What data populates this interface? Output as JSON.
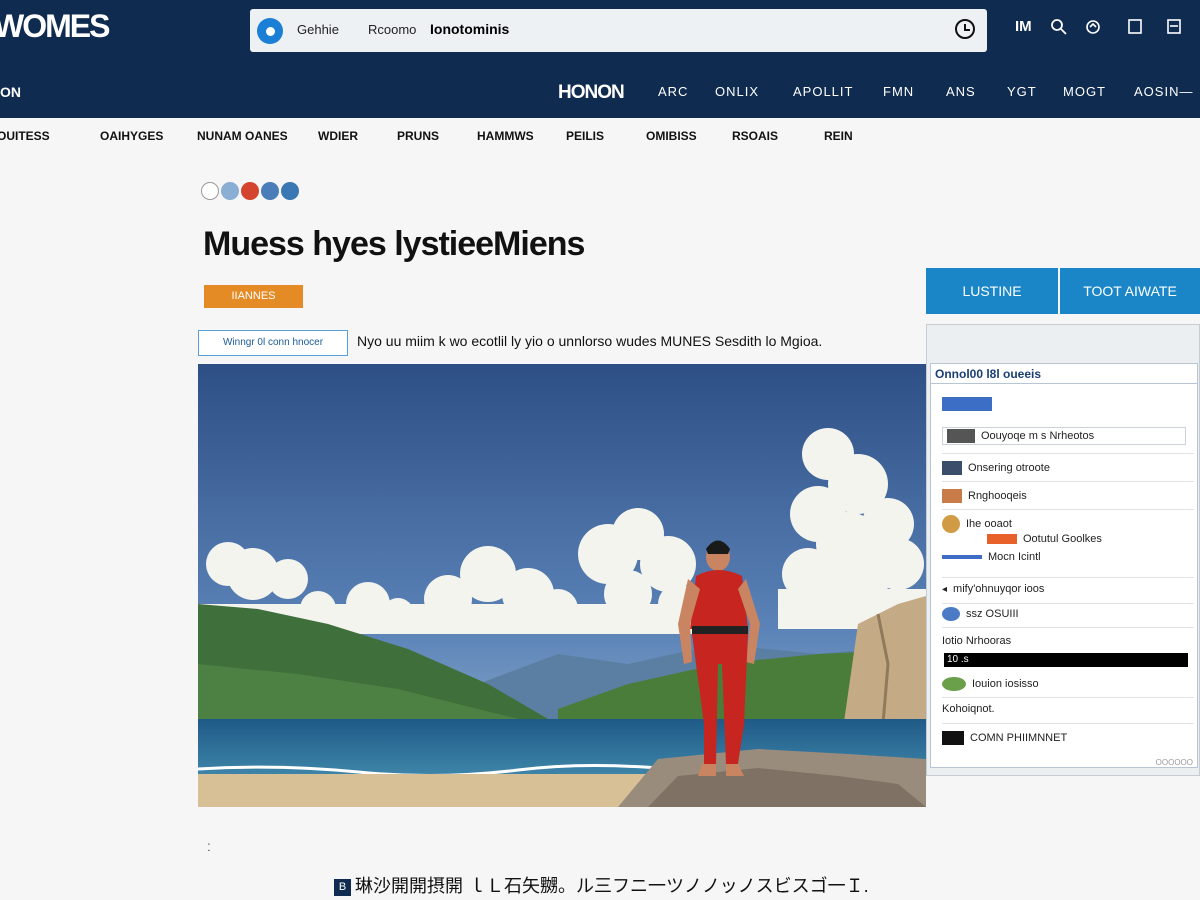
{
  "header": {
    "logo": "WOMES",
    "search": {
      "scope": "Gehhie",
      "query_label": "Rcoomo",
      "query": "Ionotominis"
    },
    "utility": {
      "im_label": "IM"
    },
    "section_label": "ON",
    "brand": "HONON",
    "nav_items": [
      "ARC",
      "ONLIX",
      "APOLLIT",
      "FMN",
      "ANS",
      "YGT",
      "MOGT",
      "AOSIN—"
    ]
  },
  "subnav": {
    "items": [
      "OUITESS",
      "OAIHYGES",
      "NUNAM OANES",
      "WDIER",
      "PRUNS",
      "HAMMWS",
      "PEILIS",
      "OMIBISS",
      "RSOAIS",
      "REIN"
    ]
  },
  "article": {
    "category_colors": [
      "#ffffff",
      "#8aaed4",
      "#d3452e",
      "#4b7eb8",
      "#3b77b3"
    ],
    "headline": "Muess hyes lystieeMiens",
    "tag": "IIANNES",
    "outline_button": "Winngr 0l conn hnocer",
    "intro": "Nyo uu miim k wo ecotlil ly yio o unnlorso wudes MUNES Sesdith lo Mgioa.",
    "footnote_mark": "ː",
    "footer_badge": "B",
    "footer_text": "琳沙開開摂開 ｌＬ石矢嬲。ル三フニ一ツノノッノスビスゴ一Ｉ."
  },
  "sidebar": {
    "tab_left": "LUSTINE",
    "tab_right": "TOOT AIWATE",
    "panel_title": "Onnol00 l8l oueeis",
    "rows": [
      {
        "text": "",
        "thumb": "#3b6ec4"
      },
      {
        "text": "Oouyoqe m s Nrheotos",
        "thumb": "#555"
      },
      {
        "text": "Onsering otroote",
        "thumb": "#3b4d6a"
      },
      {
        "text": "Rnghooqeis",
        "thumb": "#c97b4a"
      },
      {
        "text": "Ihe ooaot",
        "thumb": "#d09b44"
      },
      {
        "text": "Ootutul Goolkes",
        "thumb": "#e8602a"
      },
      {
        "text": "Mocn Icintl",
        "thumb": "#3b6ec4"
      },
      {
        "text": "mify'ohnuyqor ioos",
        "thumb": "#222"
      },
      {
        "text": "ssz OSUIII",
        "thumb": "#4a7bc4"
      },
      {
        "text": "Iotio Nrhooras",
        "thumb": "#fff"
      },
      {
        "text": "10 .s",
        "thumb": "#000"
      },
      {
        "text": "Iouion iosisso",
        "thumb": "#6aa04a"
      },
      {
        "text": "Kohoiqnot.",
        "thumb": "#fff"
      },
      {
        "text": "COMN PHIIMNNET",
        "thumb": "#111"
      }
    ],
    "footer_mark": "OOOOOO"
  }
}
